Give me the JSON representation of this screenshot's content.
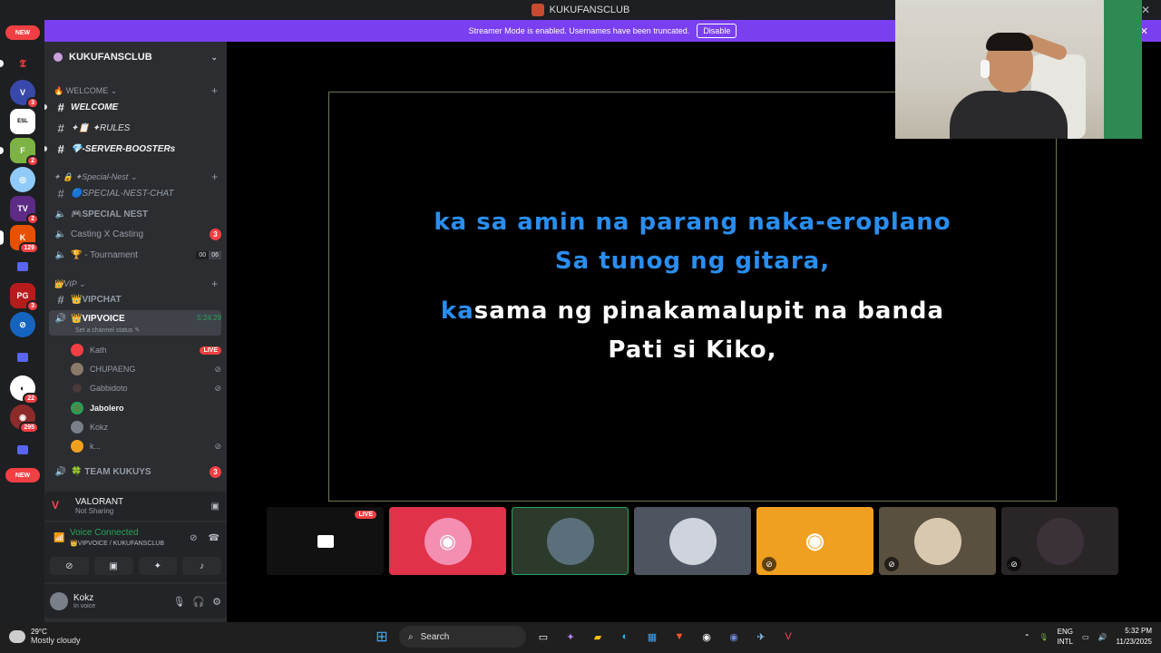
{
  "window": {
    "title": "KUKUFANSCLUB",
    "min": "—",
    "max": "☐",
    "close": "✕"
  },
  "banner": {
    "message": "Streamer Mode is enabled. Usernames have been truncated.",
    "button": "Disable",
    "close": "✕"
  },
  "guilds": {
    "new_top": "NEW",
    "new_bottom": "NEW",
    "badges": [
      "3",
      "2",
      "2",
      "129",
      "3",
      "22",
      "295"
    ]
  },
  "server": {
    "name": "KUKUFANSCLUB",
    "chevron": "⌄"
  },
  "categories": {
    "welcome": "🔥 WELCOME ⌄",
    "special": "✦ 🔒 ✦Special-Nest ⌄",
    "vip": "👑VIP ⌄",
    "plus": "+"
  },
  "channels": {
    "welcome": "WELCOME",
    "rules": "✦📋 ✦RULES",
    "boosters": "💎-SERVER-BOOSTERs",
    "special_chat": "🔵SPECIAL-NEST-CHAT",
    "special_nest": "🎮SPECIAL NEST",
    "casting": "Casting X Casting",
    "casting_count": "3",
    "tournament": "🏆 - Tournament",
    "tournament_a": "00",
    "tournament_b": "06",
    "vipchat": "👑VIPCHAT",
    "vipvoice": "👑VIPVOICE",
    "vipvoice_timer": "5:24:29",
    "vipvoice_status": "Set a channel status ✎",
    "team": "🍀 TEAM KUKUYS",
    "team_count": "3"
  },
  "voice_users": [
    {
      "name": "Kath",
      "live": "LIVE"
    },
    {
      "name": "CHUPAENG"
    },
    {
      "name": "Gabbidoto"
    },
    {
      "name": "Jabolero"
    },
    {
      "name": "Kokz"
    },
    {
      "name": "k..."
    }
  ],
  "activity": {
    "game": "VALORANT",
    "status": "Not Sharing"
  },
  "voice_panel": {
    "status": "Voice Connected",
    "location": "👑VIPVOICE / KUKUFANSCLUB"
  },
  "user": {
    "name": "Kokz",
    "status": "In voice"
  },
  "lyrics": {
    "line1": "ka sa amin na parang naka-eroplano",
    "line2": "Sa tunog ng gitara,",
    "line3_hl": "ka",
    "line3_rest": "sama ng pinakamalupit na banda",
    "line4": "Pati si Kiko,"
  },
  "tiles": {
    "live": "LIVE"
  },
  "taskbar": {
    "temp": "29°C",
    "weather": "Mostly cloudy",
    "search": "Search",
    "lang1": "ENG",
    "lang2": "INTL",
    "time": "5:32 PM",
    "date": "11/23/2025"
  },
  "colors": {
    "discord_blurple": "#5865f2",
    "streamer_banner": "#7b3ff2",
    "lyric_blue": "#2a8ef0",
    "voice_green": "#23a559",
    "live_red": "#f23f43",
    "orange_tile": "#f0a020"
  }
}
